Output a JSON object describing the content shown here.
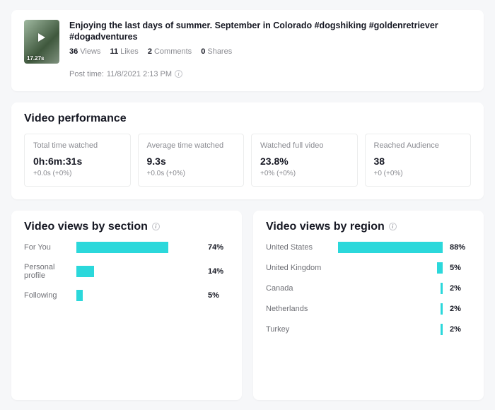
{
  "header": {
    "title": "Enjoying the last days of summer. September in Colorado #dogshiking #goldenretriever #dogadventures",
    "duration": "17.27s",
    "views_n": "36",
    "views_l": "Views",
    "likes_n": "11",
    "likes_l": "Likes",
    "comments_n": "2",
    "comments_l": "Comments",
    "shares_n": "0",
    "shares_l": "Shares",
    "posttime_label": "Post time:",
    "posttime_value": "11/8/2021 2:13 PM"
  },
  "perf": {
    "heading": "Video performance",
    "kpis": [
      {
        "label": "Total time watched",
        "value": "0h:6m:31s",
        "delta": "+0.0s (+0%)"
      },
      {
        "label": "Average time watched",
        "value": "9.3s",
        "delta": "+0.0s (+0%)"
      },
      {
        "label": "Watched full video",
        "value": "23.8%",
        "delta": "+0% (+0%)"
      },
      {
        "label": "Reached Audience",
        "value": "38",
        "delta": "+0 (+0%)"
      }
    ]
  },
  "section_chart": {
    "heading": "Video views by section",
    "rows": [
      {
        "label": "For You",
        "pct": 74,
        "txt": "74%"
      },
      {
        "label": "Personal profile",
        "pct": 14,
        "txt": "14%"
      },
      {
        "label": "Following",
        "pct": 5,
        "txt": "5%"
      }
    ]
  },
  "region_chart": {
    "heading": "Video views by region",
    "rows": [
      {
        "label": "United States",
        "pct": 88,
        "txt": "88%"
      },
      {
        "label": "United Kingdom",
        "pct": 5,
        "txt": "5%"
      },
      {
        "label": "Canada",
        "pct": 2,
        "txt": "2%"
      },
      {
        "label": "Netherlands",
        "pct": 2,
        "txt": "2%"
      },
      {
        "label": "Turkey",
        "pct": 2,
        "txt": "2%"
      }
    ]
  },
  "chart_data": [
    {
      "type": "bar",
      "title": "Video views by section",
      "orientation": "horizontal",
      "categories": [
        "For You",
        "Personal profile",
        "Following"
      ],
      "values": [
        74,
        14,
        5
      ],
      "xlabel": "",
      "ylabel": "",
      "unit": "%",
      "xlim": [
        0,
        100
      ]
    },
    {
      "type": "bar",
      "title": "Video views by region",
      "orientation": "horizontal",
      "categories": [
        "United States",
        "United Kingdom",
        "Canada",
        "Netherlands",
        "Turkey"
      ],
      "values": [
        88,
        5,
        2,
        2,
        2
      ],
      "xlabel": "",
      "ylabel": "",
      "unit": "%",
      "xlim": [
        0,
        100
      ]
    }
  ],
  "colors": {
    "bar": "#2bd8db"
  }
}
